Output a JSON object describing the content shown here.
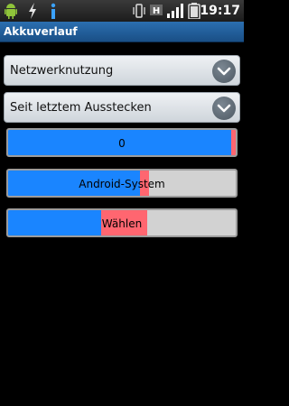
{
  "status_bar": {
    "time": "19:17",
    "icons": [
      "android-icon",
      "usb-icon",
      "info-icon",
      "vibrate-icon",
      "h-network-icon",
      "signal-icon",
      "battery-icon"
    ]
  },
  "title_bar": {
    "title": "Akkuverlauf"
  },
  "dropdowns": [
    {
      "label": "Netzwerknutzung"
    },
    {
      "label": "Seit letztem Ausstecken"
    }
  ],
  "usage_bars": [
    {
      "label": "0",
      "blue_percent": 98,
      "red_percent": 2
    },
    {
      "label": "Android-System",
      "blue_percent": 58,
      "red_percent": 4
    },
    {
      "label": "Wählen",
      "blue_percent": 41,
      "red_percent": 20
    }
  ],
  "colors": {
    "blue": "#1a85ff",
    "red": "#ff6670",
    "title_bg": "#1a4f86"
  }
}
